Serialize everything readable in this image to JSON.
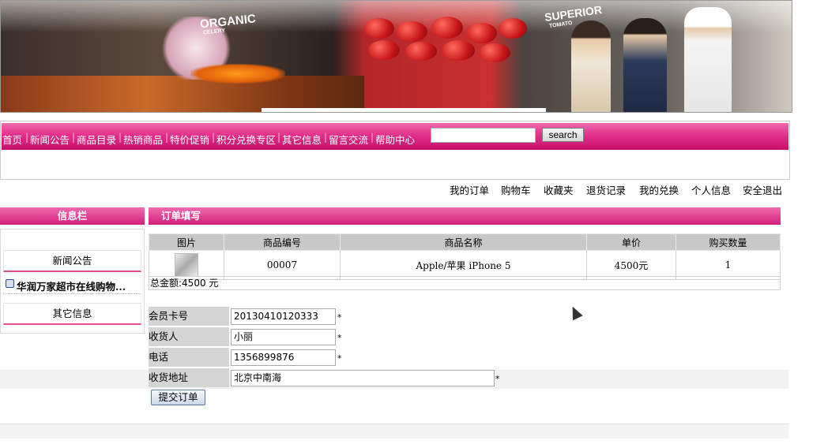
{
  "banner": {
    "sign_organic": "ORGANIC",
    "sign_organic_sub": "CELERY",
    "sign_superior": "SUPERIOR",
    "sign_superior_sub": "TOMATO"
  },
  "nav": {
    "items": [
      "首页",
      "新闻公告",
      "商品目录",
      "热销商品",
      "特价促销",
      "积分兑换专区",
      "其它信息",
      "留言交流",
      "帮助中心"
    ],
    "search_value": "",
    "search_button": "search"
  },
  "user_links": [
    "我的订单",
    "购物车",
    "收藏夹",
    "退货记录",
    "我的兑换",
    "个人信息",
    "安全退出"
  ],
  "sidebar": {
    "title": "信息栏",
    "news_button": "新闻公告",
    "news_item": "华润万家超市在线购物...",
    "other_button": "其它信息"
  },
  "order": {
    "title": "订单填写",
    "columns": [
      "图片",
      "商品编号",
      "商品名称",
      "单价",
      "购买数量"
    ],
    "rows": [
      {
        "code": "00007",
        "name": "Apple/苹果  iPhone 5",
        "price": "4500元",
        "qty": "1"
      }
    ],
    "total": "总金额:4500 元"
  },
  "form": {
    "card_label": "会员卡号",
    "card_value": "20130410120333",
    "receiver_label": "收货人",
    "receiver_value": "小丽",
    "phone_label": "电话",
    "phone_value": "1356899876",
    "address_label": "收货地址",
    "address_value": "北京中南海",
    "required_mark": "*",
    "submit": "提交订单"
  },
  "colors": {
    "accent": "#e2308a",
    "header_gray": "#c8c8c8"
  }
}
